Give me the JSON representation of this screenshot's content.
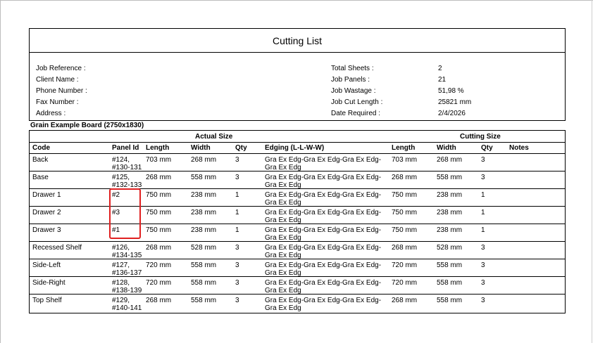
{
  "document": {
    "title": "Cutting List",
    "info_left": [
      {
        "label": "Job Reference :",
        "value": ""
      },
      {
        "label": "Client Name :",
        "value": ""
      },
      {
        "label": "Phone Number :",
        "value": ""
      },
      {
        "label": "Fax Number :",
        "value": ""
      },
      {
        "label": "Address :",
        "value": ""
      }
    ],
    "info_right": [
      {
        "label": "Total Sheets :",
        "value": "2"
      },
      {
        "label": "Job Panels :",
        "value": "21"
      },
      {
        "label": "Job Wastage :",
        "value": "51,98 %"
      },
      {
        "label": "Job Cut Length :",
        "value": "25821 mm"
      },
      {
        "label": "Date Required :",
        "value": "2/4/2026"
      }
    ],
    "board_title": "Grain Example Board (2750x1830)",
    "table": {
      "group_actual": "Actual Size",
      "group_cutting": "Cutting Size",
      "headers": {
        "code": "Code",
        "panel_id": "Panel Id",
        "length": "Length",
        "width": "Width",
        "qty": "Qty",
        "edging": "Edging (L-L-W-W)",
        "cut_length": "Length",
        "cut_width": "Width",
        "cut_qty": "Qty",
        "notes": "Notes"
      },
      "rows": [
        {
          "code": "Back",
          "panel_id": "#124,\n#130-131",
          "length": "703 mm",
          "width": "268 mm",
          "qty": "3",
          "edging": "Gra Ex Edg-Gra Ex Edg-Gra Ex Edg-Gra Ex Edg",
          "cut_length": "703 mm",
          "cut_width": "268 mm",
          "cut_qty": "3"
        },
        {
          "code": "Base",
          "panel_id": "#125,\n#132-133",
          "length": "268 mm",
          "width": "558 mm",
          "qty": "3",
          "edging": "Gra Ex Edg-Gra Ex Edg-Gra Ex Edg-Gra Ex Edg",
          "cut_length": "268 mm",
          "cut_width": "558 mm",
          "cut_qty": "3"
        },
        {
          "code": "Drawer 1",
          "panel_id": "#2",
          "length": "750 mm",
          "width": "238 mm",
          "qty": "1",
          "edging": "Gra Ex Edg-Gra Ex Edg-Gra Ex Edg-Gra Ex Edg",
          "cut_length": "750 mm",
          "cut_width": "238 mm",
          "cut_qty": "1"
        },
        {
          "code": "Drawer 2",
          "panel_id": "#3",
          "length": "750 mm",
          "width": "238 mm",
          "qty": "1",
          "edging": "Gra Ex Edg-Gra Ex Edg-Gra Ex Edg-Gra Ex Edg",
          "cut_length": "750 mm",
          "cut_width": "238 mm",
          "cut_qty": "1"
        },
        {
          "code": "Drawer 3",
          "panel_id": "#1",
          "length": "750 mm",
          "width": "238 mm",
          "qty": "1",
          "edging": "Gra Ex Edg-Gra Ex Edg-Gra Ex Edg-Gra Ex Edg",
          "cut_length": "750 mm",
          "cut_width": "238 mm",
          "cut_qty": "1"
        },
        {
          "code": "Recessed Shelf",
          "panel_id": "#126,\n#134-135",
          "length": "268 mm",
          "width": "528 mm",
          "qty": "3",
          "edging": "Gra Ex Edg-Gra Ex Edg-Gra Ex Edg-Gra Ex Edg",
          "cut_length": "268 mm",
          "cut_width": "528 mm",
          "cut_qty": "3"
        },
        {
          "code": "Side-Left",
          "panel_id": "#127,\n#136-137",
          "length": "720 mm",
          "width": "558 mm",
          "qty": "3",
          "edging": "Gra Ex Edg-Gra Ex Edg-Gra Ex Edg-Gra Ex Edg",
          "cut_length": "720 mm",
          "cut_width": "558 mm",
          "cut_qty": "3"
        },
        {
          "code": "Side-Right",
          "panel_id": "#128,\n#138-139",
          "length": "720 mm",
          "width": "558 mm",
          "qty": "3",
          "edging": "Gra Ex Edg-Gra Ex Edg-Gra Ex Edg-Gra Ex Edg",
          "cut_length": "720 mm",
          "cut_width": "558 mm",
          "cut_qty": "3"
        },
        {
          "code": "Top Shelf",
          "panel_id": "#129,\n#140-141",
          "length": "268 mm",
          "width": "558 mm",
          "qty": "3",
          "edging": "Gra Ex Edg-Gra Ex Edg-Gra Ex Edg-Gra Ex Edg",
          "cut_length": "268 mm",
          "cut_width": "558 mm",
          "cut_qty": "3"
        }
      ]
    },
    "highlight_color": "#e02020"
  }
}
